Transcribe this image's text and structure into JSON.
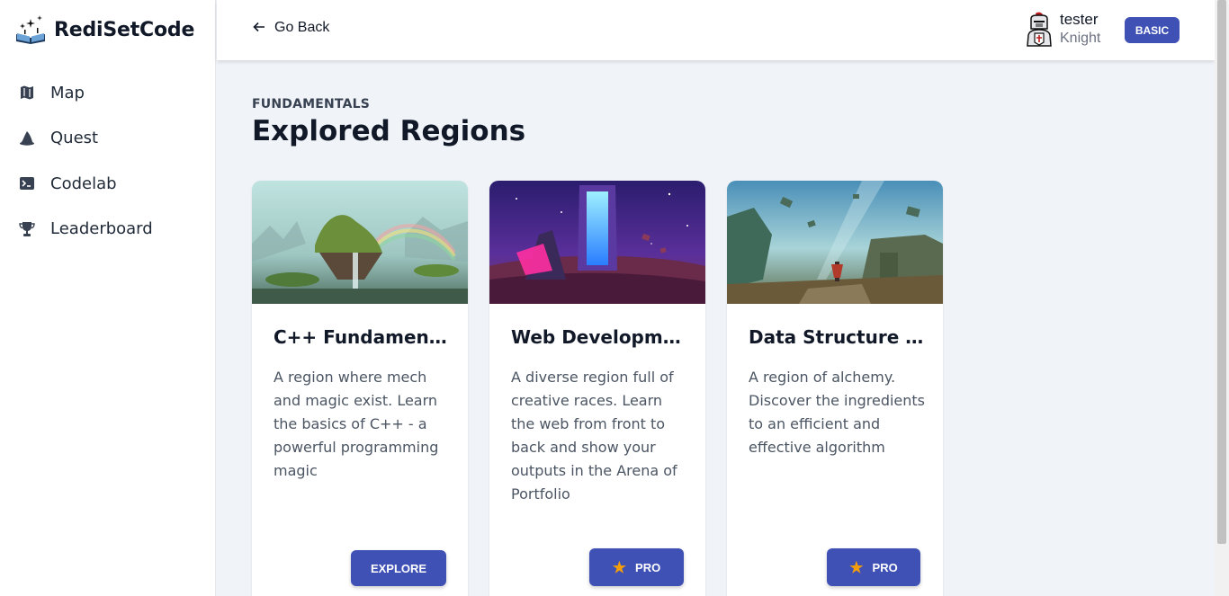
{
  "brand": {
    "name": "RediSetCode",
    "icon": "book-sparkle-icon"
  },
  "nav": {
    "items": [
      {
        "label": "Map",
        "icon": "map-icon"
      },
      {
        "label": "Quest",
        "icon": "wizard-hat-icon"
      },
      {
        "label": "Codelab",
        "icon": "terminal-icon"
      },
      {
        "label": "Leaderboard",
        "icon": "trophy-icon"
      }
    ]
  },
  "topbar": {
    "go_back": "Go Back",
    "user": {
      "name": "tester",
      "role": "Knight",
      "avatar": "knight-avatar"
    },
    "plan": "BASIC"
  },
  "main": {
    "eyebrow": "FUNDAMENTALS",
    "title": "Explored Regions",
    "cards": [
      {
        "title": "C++ Fundament...",
        "description": "A region where mech and magic exist. Learn the basics of C++ - a powerful programming magic",
        "button": "EXPLORE"
      },
      {
        "title": "Web Developme...",
        "description": "A diverse region full of creative races. Learn the web from front to back and show your outputs in the Arena of Portfolio",
        "button": "PRO",
        "button_icon": "star-icon"
      },
      {
        "title": "Data Structure &...",
        "description": "A region of alchemy. Discover the ingredients to an efficient and effective algorithm",
        "button": "PRO",
        "button_icon": "star-icon"
      }
    ]
  },
  "colors": {
    "accent": "#3f51b5",
    "star": "#f59e0b",
    "background": "#f0f4f8"
  }
}
